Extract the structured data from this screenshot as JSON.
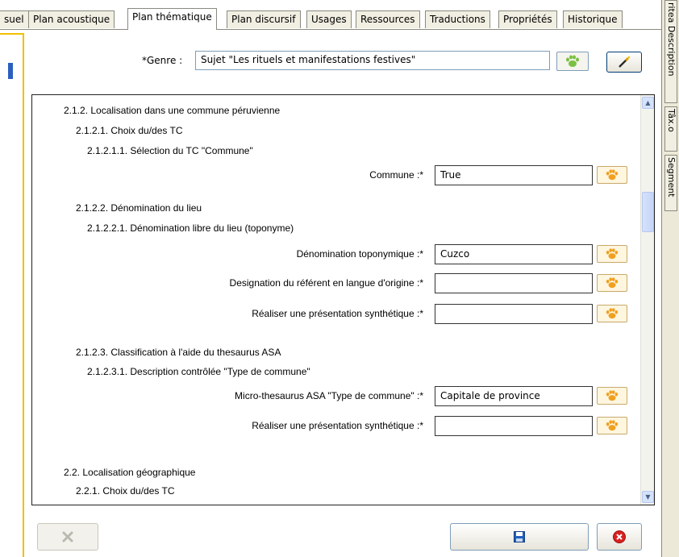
{
  "tabs": [
    "suel",
    "Plan acoustique",
    "Plan thématique",
    "Plan discursif",
    "Usages",
    "Ressources",
    "Traductions",
    "Propriétés",
    "Historique"
  ],
  "active_tab": "Plan thématique",
  "side_tabs": [
    "ritea Description",
    "Tâx.o",
    "Segment"
  ],
  "genre": {
    "label": "*Genre :",
    "value": "Sujet \"Les rituels et manifestations festives\""
  },
  "outline": {
    "h_2_1_2": "2.1.2. Localisation dans une commune péruvienne",
    "h_2_1_2_1": "2.1.2.1. Choix du/des TC",
    "h_2_1_2_1_1": "2.1.2.1.1. Sélection du TC \"Commune\"",
    "commune_label": "Commune :*",
    "commune_value": "True",
    "h_2_1_2_2": "2.1.2.2. Dénomination du lieu",
    "h_2_1_2_2_1": "2.1.2.2.1. Dénomination libre du lieu (toponyme)",
    "denom_label": "Dénomination toponymique :*",
    "denom_value": "Cuzco",
    "designation_label": "Designation du référent en langue d'origine :*",
    "designation_value": "",
    "synth1_label": "Réaliser une présentation synthétique :*",
    "synth1_value": "",
    "h_2_1_2_3": "2.1.2.3. Classification à l'aide du thesaurus ASA",
    "h_2_1_2_3_1": "2.1.2.3.1. Description contrôlée \"Type de commune\"",
    "micro_label": "Micro-thesaurus ASA \"Type de commune\" :*",
    "micro_value": "Capitale de province",
    "synth2_label": "Réaliser une présentation synthétique :*",
    "synth2_value": "",
    "h_2_2": "2.2. Localisation géographique",
    "h_2_2_1": "2.2.1. Choix du/des TC"
  },
  "colors": {
    "paw_green": "#7bc043",
    "paw_orange": "#f0a020",
    "save_blue": "#1e5fbf",
    "cancel_red": "#d82020"
  }
}
